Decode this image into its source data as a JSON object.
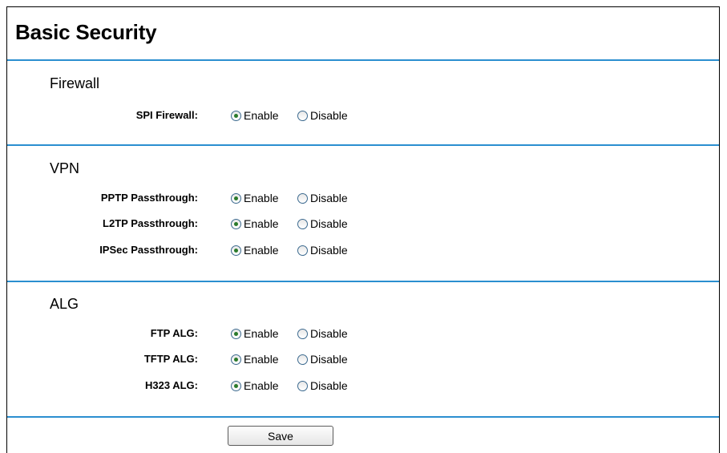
{
  "page": {
    "title": "Basic Security"
  },
  "sections": {
    "firewall": {
      "title": "Firewall",
      "rows": [
        {
          "label": "SPI Firewall:",
          "selected": "Enable"
        }
      ]
    },
    "vpn": {
      "title": "VPN",
      "rows": [
        {
          "label": "PPTP Passthrough:",
          "selected": "Enable"
        },
        {
          "label": "L2TP Passthrough:",
          "selected": "Enable"
        },
        {
          "label": "IPSec Passthrough:",
          "selected": "Enable"
        }
      ]
    },
    "alg": {
      "title": "ALG",
      "rows": [
        {
          "label": "FTP ALG:",
          "selected": "Enable"
        },
        {
          "label": "TFTP ALG:",
          "selected": "Enable"
        },
        {
          "label": "H323 ALG:",
          "selected": "Enable"
        }
      ]
    }
  },
  "options": {
    "enable": "Enable",
    "disable": "Disable"
  },
  "buttons": {
    "save": "Save"
  },
  "colors": {
    "divider": "#2b8fd0",
    "radio_dot": "#2a7a2a"
  }
}
